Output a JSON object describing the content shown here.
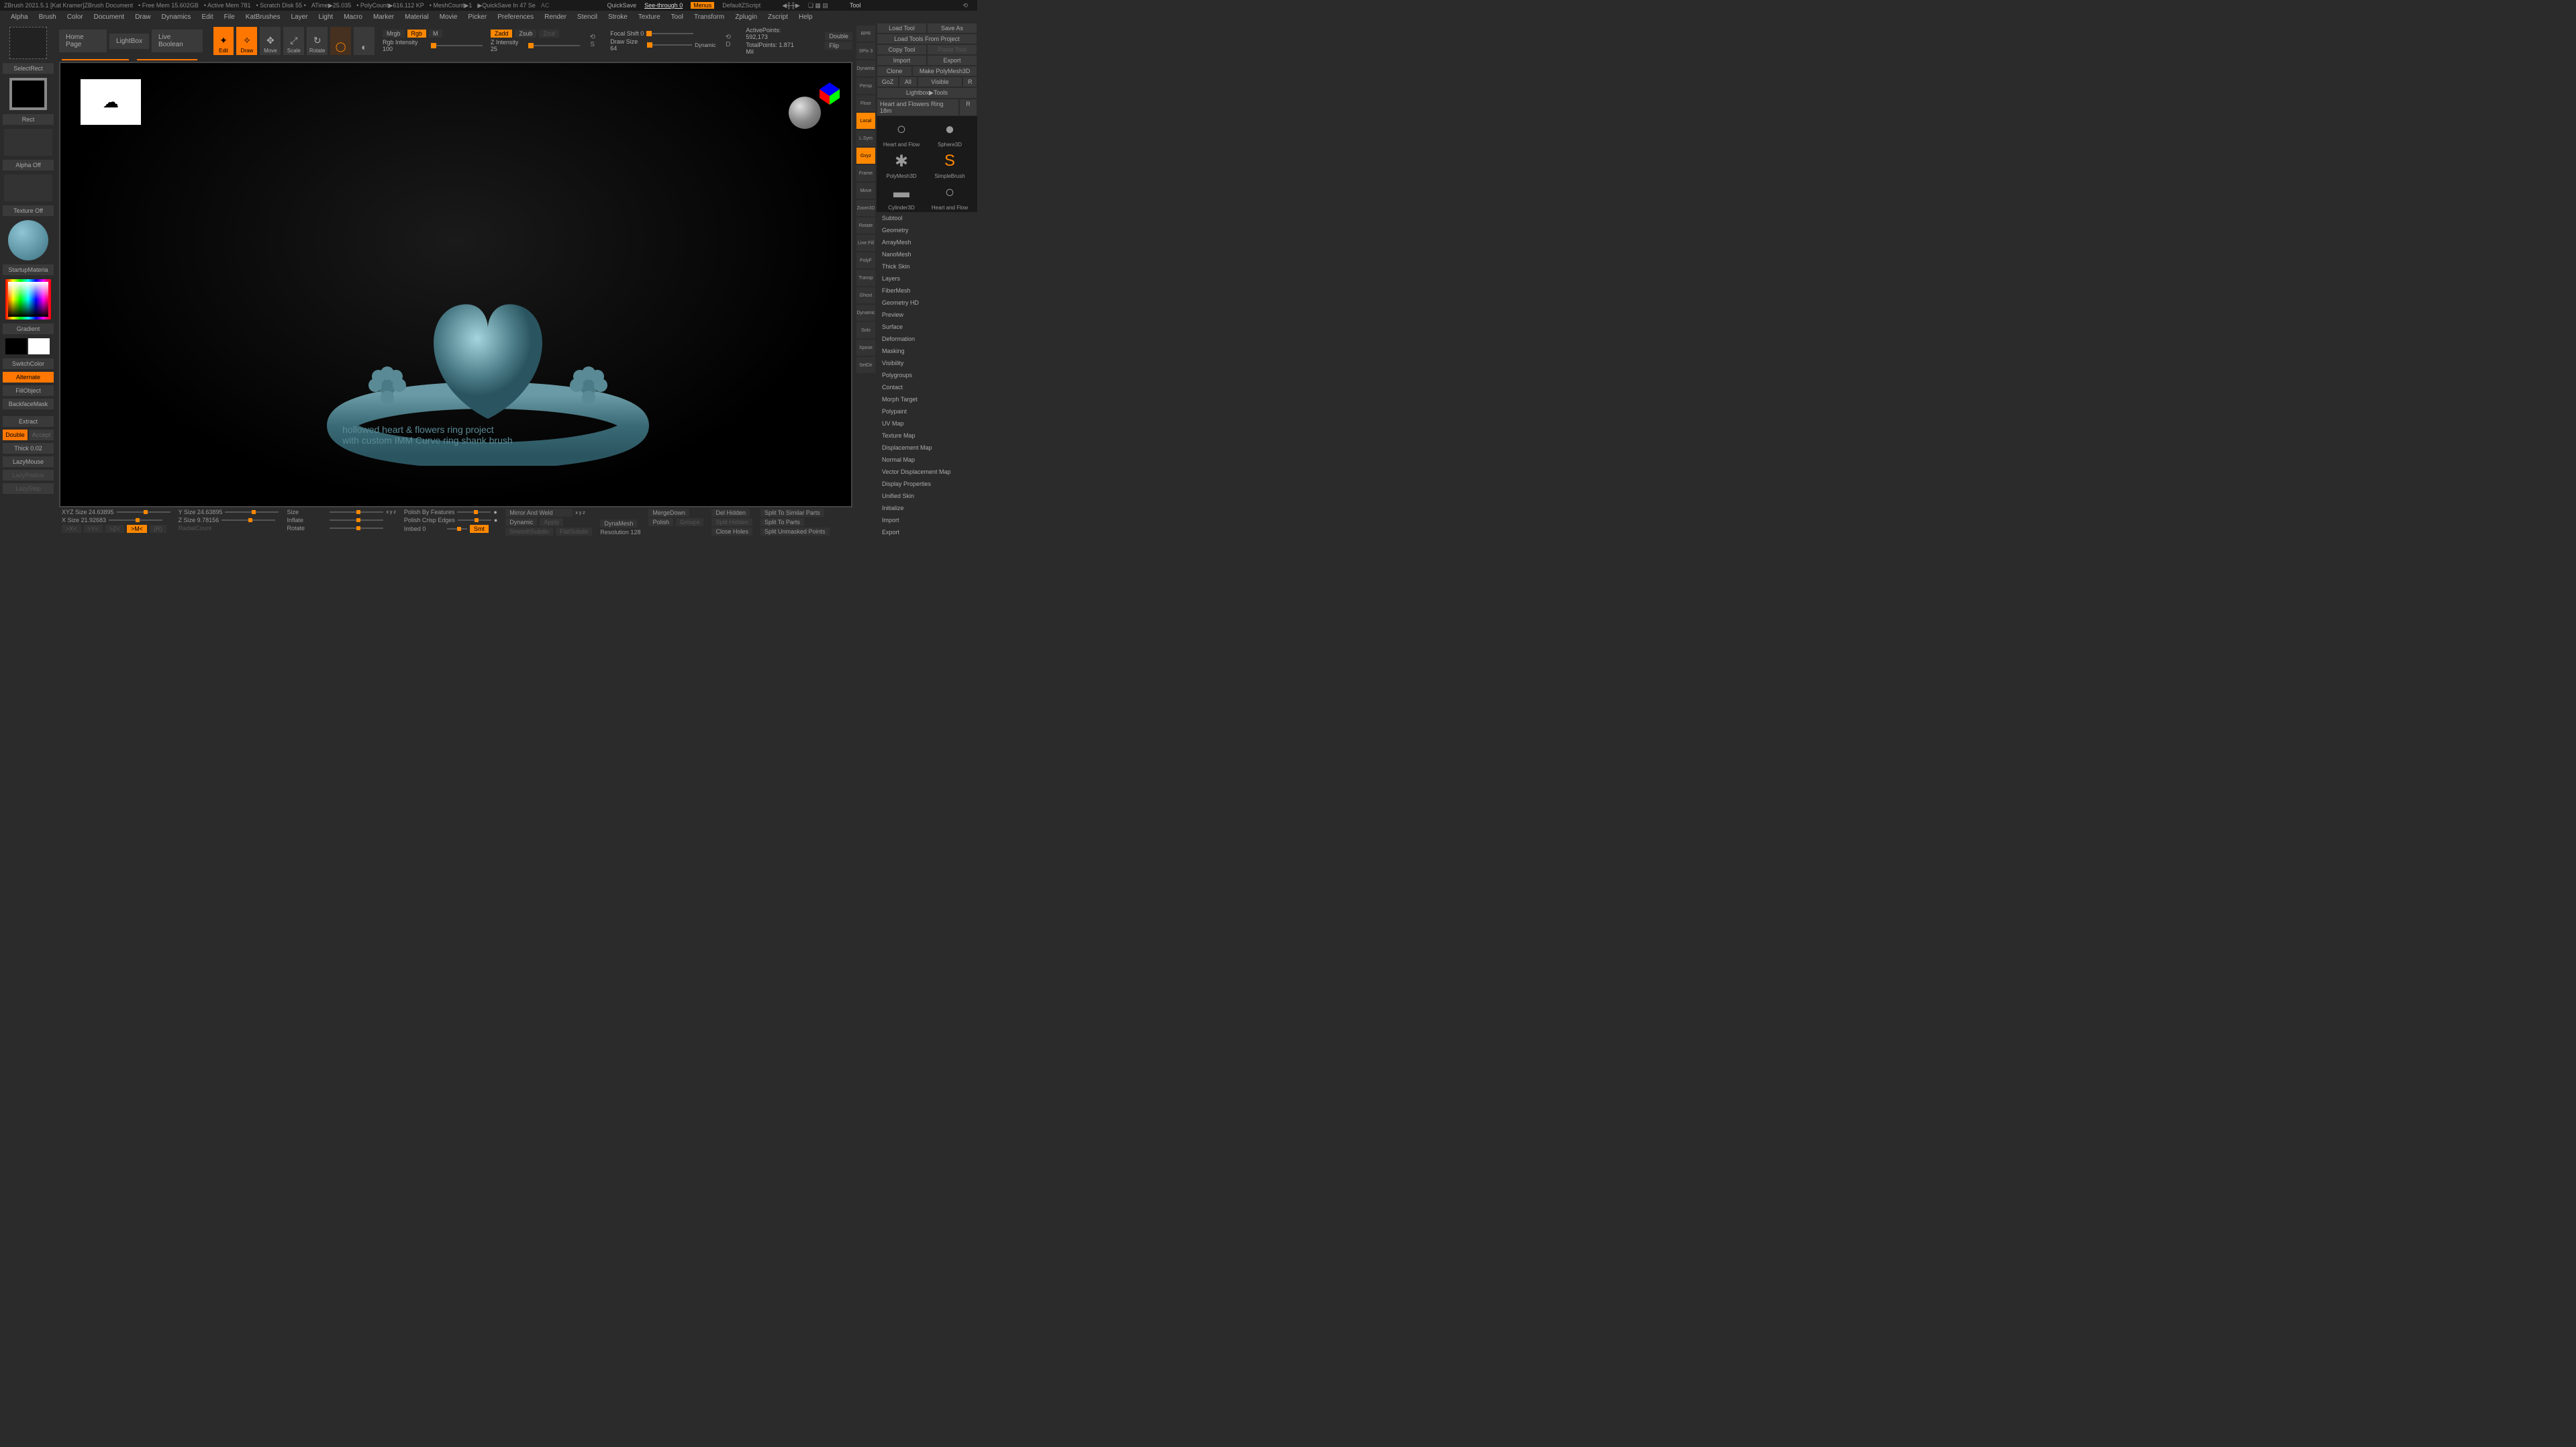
{
  "title_bar": {
    "app": "ZBrush 2021.5.1 [Kat Kramer]ZBrush Document",
    "free_mem": "• Free Mem 15.602GB",
    "active_mem": "• Active Mem 781",
    "scratch": "• Scratch Disk 55 •",
    "atime": "ATime▶25.035",
    "polycount": "• PolyCount▶616.112 KP",
    "meshcount": "• MeshCount▶1",
    "quicksave_in": "▶QuickSave In 47 Se",
    "quicksave": "QuickSave",
    "seethrough": "See-through 0",
    "menus": "Menus",
    "default_zscript": "DefaultZScript",
    "tool": "Tool"
  },
  "menus": [
    "Alpha",
    "Brush",
    "Color",
    "Document",
    "Draw",
    "Dynamics",
    "Edit",
    "File",
    "KatBrushes",
    "Layer",
    "Light",
    "Macro",
    "Marker",
    "Material",
    "Movie",
    "Picker",
    "Preferences",
    "Render",
    "Stencil",
    "Stroke",
    "Texture",
    "Tool",
    "Transform",
    "Zplugin",
    "Zscript",
    "Help"
  ],
  "top_tabs": [
    "Home Page",
    "LightBox",
    "Live Boolean"
  ],
  "mode_buttons": {
    "edit": "Edit",
    "draw": "Draw",
    "move": "Move",
    "scale": "Scale",
    "rotate": "Rotate"
  },
  "sliders": {
    "mrgb": "Mrgb",
    "rgb": "Rgb",
    "m": "M",
    "rgb_intensity": "Rgb Intensity 100",
    "zadd": "Zadd",
    "zsub": "Zsub",
    "zcut": "Zcut",
    "z_intensity": "Z Intensity 25",
    "focal_shift": "Focal Shift 0",
    "draw_size": "Draw Size 64",
    "dynamic": "Dynamic",
    "active_points": "ActivePoints: 592,173",
    "total_points": "TotalPoints: 1.871 Mil",
    "double": "Double",
    "flip": "Flip"
  },
  "left": {
    "select_rect": "SelectRect",
    "rect": "Rect",
    "alpha_off": "Alpha Off",
    "texture_off": "Texture Off",
    "startup_material": "StartupMateria",
    "gradient": "Gradient",
    "switch_color": "SwitchColor",
    "alternate": "Alternate",
    "fill_object": "FillObject",
    "backface_mask": "BackfaceMask",
    "extract": "Extract",
    "double": "Double",
    "accept": "Accept",
    "thick": "Thick 0.02",
    "lazy_mouse": "LazyMouse",
    "lazy_radius": "LazyRadius",
    "lazy_step": "LazyStep"
  },
  "overlay": {
    "line1": "hollowed heart & flowers ring project",
    "line2": "with custom IMM Curve ring shank brush"
  },
  "right_rail": [
    "BPR",
    "SPix 3",
    "Dynamic",
    "Persp",
    "Floor",
    "Local",
    "L.Sym",
    "Gxyz",
    "Frame",
    "Move",
    "Zoom3D",
    "Rotate",
    "Line Fill",
    "PolyF",
    "Transp",
    "Ghost",
    "Dynamic",
    "Solo",
    "Xpose",
    "SetDir"
  ],
  "right_panel": {
    "load_tool": "Load Tool",
    "save_as": "Save As",
    "load_project": "Load Tools From Project",
    "copy_tool": "Copy Tool",
    "paste_tool": "Paste Tool",
    "import": "Import",
    "export": "Export",
    "clone": "Clone",
    "make_polymesh": "Make PolyMesh3D",
    "goz": "GoZ",
    "all": "All",
    "visible": "Visible",
    "r": "R",
    "lightbox_tools": "Lightbox▶Tools",
    "tool_name": "Heart and Flowers Ring 18m",
    "tools": [
      {
        "name": "Heart and Flow",
        "icon": "○"
      },
      {
        "name": "Sphere3D",
        "icon": "●"
      },
      {
        "name": "PolyMesh3D",
        "icon": "✱"
      },
      {
        "name": "SimpleBrush",
        "icon": "S"
      },
      {
        "name": "Cylinder3D",
        "icon": "▬"
      },
      {
        "name": "Heart and Flow",
        "icon": "○"
      }
    ],
    "subpalettes": [
      "Subtool",
      "Geometry",
      "ArrayMesh",
      "NanoMesh",
      "Thick Skin",
      "Layers",
      "FiberMesh",
      "Geometry HD",
      "Preview",
      "Surface",
      "Deformation",
      "Masking",
      "Visibility",
      "Polygroups",
      "Contact",
      "Morph Target",
      "Polypaint",
      "UV Map",
      "Texture Map",
      "Displacement Map",
      "Normal Map",
      "Vector Displacement Map",
      "Display Properties",
      "Unified Skin",
      "Initialize",
      "Import",
      "Export"
    ]
  },
  "bottom": {
    "xyz_size": "XYZ Size 24.63895",
    "y_size": "Y Size 24.63895",
    "x_size": "X Size 21.92683",
    "z_size": "Z Size 9.78156",
    "size": "Size",
    "inflate": "Inflate",
    "rotate": "Rotate",
    "radial_count": "RadialCount",
    "polish_features": "Polish By Features",
    "polish_crisp": "Polish Crisp Edges",
    "imbed": "Imbed 0",
    "smt": "Smt",
    "mirror_weld": "Mirror And Weld",
    "dynamic": "Dynamic",
    "apply": "Apply",
    "smooth_subdiv": "SmoothSubdiv",
    "flat_subdiv": "FlatSubdiv",
    "dynamesh": "DynaMesh",
    "polish": "Polish",
    "groups": "Groups",
    "resolution": "Resolution 128",
    "merge_down": "MergeDown",
    "del_hidden": "Del Hidden",
    "split_hidden": "Split Hidden",
    "close_holes": "Close Holes",
    "split_similar": "Split To Similar Parts",
    "split_parts": "Split To Parts",
    "split_unmasked": "Split Unmasked Points",
    "axis": {
      "x": ">X<",
      "y": ">Y<",
      "z": ">Z<",
      "m": ">M<",
      "r": "(R)"
    }
  }
}
